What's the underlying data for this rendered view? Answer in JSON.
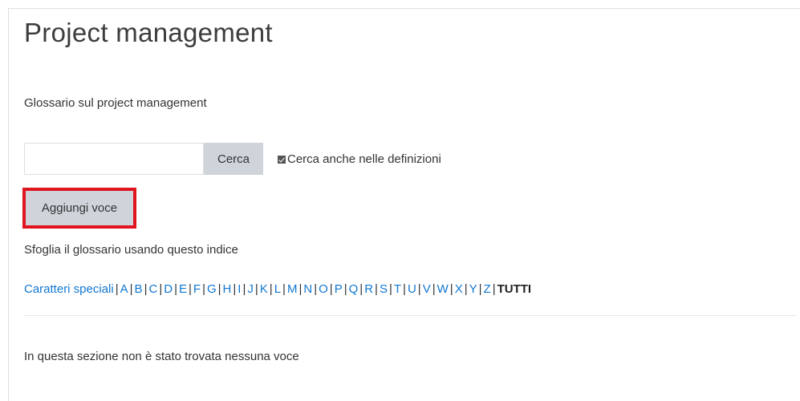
{
  "page": {
    "title": "Project management",
    "intro": "Glossario sul project management"
  },
  "search": {
    "value": "",
    "placeholder": "",
    "button_label": "Cerca",
    "full_search_label": "Cerca anche nelle definizioni",
    "full_search_checked": true
  },
  "actions": {
    "add_entry_label": "Aggiungi voce",
    "highlight_color": "#e0151f"
  },
  "browse": {
    "label": "Sfoglia il glossario usando questo indice",
    "special_label": "Caratteri speciali",
    "letters": [
      "A",
      "B",
      "C",
      "D",
      "E",
      "F",
      "G",
      "H",
      "I",
      "J",
      "K",
      "L",
      "M",
      "N",
      "O",
      "P",
      "Q",
      "R",
      "S",
      "T",
      "U",
      "V",
      "W",
      "X",
      "Y",
      "Z"
    ],
    "all_label": "TUTTI",
    "separator": "|",
    "link_color": "#1177d1"
  },
  "results": {
    "empty_message": "In questa sezione non è stato trovata nessuna voce"
  }
}
